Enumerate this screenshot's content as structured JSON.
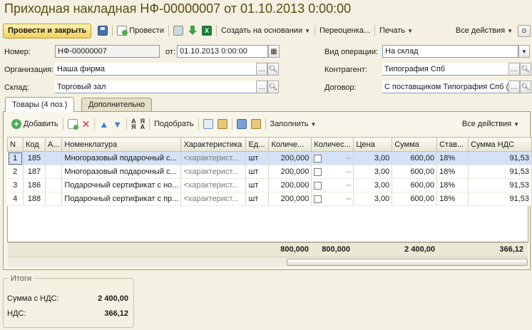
{
  "window": {
    "title": "Приходная накладная НФ-00000007 от 01.10.2013 0:00:00"
  },
  "toolbar": {
    "post_close": "Провести и закрыть",
    "post": "Провести",
    "create_basis": "Создать на основании",
    "revaluation": "Переоценка...",
    "print": "Печать",
    "all_actions": "Все действия"
  },
  "form": {
    "number_label": "Номер:",
    "number_value": "НФ-00000007",
    "date_label": "от:",
    "date_value": "01.10.2013  0:00:00",
    "org_label": "Организация:",
    "org_value": "Наша фирма",
    "warehouse_label": "Склад:",
    "warehouse_value": "Торговый зал",
    "op_label": "Вид операции:",
    "op_value": "На склад",
    "counterparty_label": "Контрагент:",
    "counterparty_value": "Типография Спб",
    "contract_label": "Договор:",
    "contract_value": "С поставщиком Типография Спб ("
  },
  "tabs": [
    {
      "label": "Товары (4 поз.)"
    },
    {
      "label": "Дополнительно"
    }
  ],
  "table_toolbar": {
    "add": "Добавить",
    "pick": "Подобрать",
    "fill": "Заполнить",
    "all_actions": "Все действия"
  },
  "grid": {
    "columns": [
      "N",
      "Код",
      "А...",
      "Номенклатура",
      "Характеристика",
      "Ед...",
      "Количе...",
      "Количес...",
      "Цена",
      "Сумма",
      "Став...",
      "Сумма НДС"
    ],
    "rows": [
      {
        "n": "1",
        "code": "185",
        "name": "Многоразовый подарочный с...",
        "char": "<характерист...",
        "unit": "шт",
        "qty": "200,000",
        "qty2": "--",
        "price": "3,00",
        "sum": "600,00",
        "rate": "18%",
        "vat": "91,53"
      },
      {
        "n": "2",
        "code": "187",
        "name": "Многоразовый подарочный с...",
        "char": "<характерист...",
        "unit": "шт",
        "qty": "200,000",
        "qty2": "--",
        "price": "3,00",
        "sum": "600,00",
        "rate": "18%",
        "vat": "91,53"
      },
      {
        "n": "3",
        "code": "186",
        "name": "Подарочный сертификат с но...",
        "char": "<характерист...",
        "unit": "шт",
        "qty": "200,000",
        "qty2": "--",
        "price": "3,00",
        "sum": "600,00",
        "rate": "18%",
        "vat": "91,53"
      },
      {
        "n": "4",
        "code": "188",
        "name": "Подарочный сертификат с пр...",
        "char": "<характерист...",
        "unit": "шт",
        "qty": "200,000",
        "qty2": "--",
        "price": "3,00",
        "sum": "600,00",
        "rate": "18%",
        "vat": "91,53"
      }
    ],
    "totals": {
      "qty": "800,000",
      "qty2": "800,000",
      "sum": "2 400,00",
      "vat": "366,12"
    }
  },
  "summary": {
    "title": "Итоги",
    "total_label": "Сумма с НДС:",
    "total_value": "2 400,00",
    "vat_label": "НДС:",
    "vat_value": "366,12"
  },
  "colors": {
    "background": "#f4f1e2",
    "title": "#5a4a14",
    "primary_button": "#f1d35c",
    "selected_row": "#d3e2f6"
  }
}
